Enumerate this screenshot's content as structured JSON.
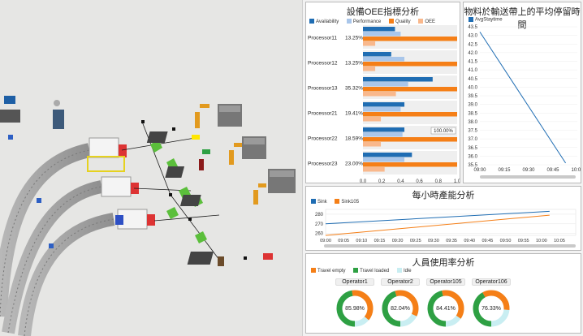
{
  "scene": {
    "description_icons": [
      "conveyor",
      "processor",
      "robot-arm",
      "operator",
      "machine",
      "queue",
      "sink",
      "network-node"
    ]
  },
  "oee": {
    "title": "設備OEE指標分析",
    "legend": [
      {
        "name": "Availability",
        "color": "#1f6db3"
      },
      {
        "name": "Performance",
        "color": "#a9c6ea"
      },
      {
        "name": "Quality",
        "color": "#f57f17"
      },
      {
        "name": "OEE",
        "color": "#f9b88c"
      }
    ],
    "rows": [
      {
        "name": "Processor11",
        "pct": "13.25%",
        "values": [
          0.34,
          0.4,
          1.0,
          0.13
        ]
      },
      {
        "name": "Processor12",
        "pct": "13.25%",
        "values": [
          0.3,
          0.44,
          1.0,
          0.13
        ]
      },
      {
        "name": "Processor13",
        "pct": "35.32%",
        "values": [
          0.74,
          0.48,
          1.0,
          0.35
        ]
      },
      {
        "name": "Processor21",
        "pct": "19.41%",
        "values": [
          0.44,
          0.4,
          1.0,
          0.19
        ]
      },
      {
        "name": "Processor22",
        "pct": "18.59%",
        "values": [
          0.44,
          0.42,
          1.0,
          0.19
        ]
      },
      {
        "name": "Processor23",
        "pct": "23.00%",
        "values": [
          0.52,
          0.44,
          1.0,
          0.23
        ]
      }
    ],
    "xticks": [
      "0.0",
      "0.2",
      "0.4",
      "0.6",
      "0.8",
      "1.0"
    ],
    "tooltip": "100.00%"
  },
  "stay": {
    "title": "物料於輸送帶上的平均停留時間",
    "legend": "AvgStaytime",
    "yticks": [
      "43.5",
      "43.0",
      "42.5",
      "42.0",
      "41.5",
      "41.0",
      "40.5",
      "40.0",
      "39.5",
      "39.0",
      "38.5",
      "38.0",
      "37.5",
      "37.0",
      "36.5",
      "36.0",
      "35.5"
    ],
    "xticks": [
      "09:00",
      "09:15",
      "09:30",
      "09:45",
      "10:00"
    ],
    "line_color": "#1f6db3"
  },
  "throughput": {
    "title": "每小時產能分析",
    "legend": [
      {
        "name": "Sink",
        "color": "#1f6db3"
      },
      {
        "name": "Sink105",
        "color": "#f57f17"
      }
    ],
    "yticks": [
      "280",
      "270",
      "260"
    ],
    "xticks": [
      "09:00",
      "09:05",
      "09:10",
      "09:15",
      "09:20",
      "09:25",
      "09:30",
      "09:35",
      "09:40",
      "09:45",
      "09:50",
      "09:55",
      "10:00",
      "10:05"
    ]
  },
  "staff": {
    "title": "人員使用率分析",
    "legend": [
      {
        "name": "Travel empty",
        "color": "#f57f17"
      },
      {
        "name": "Travel loaded",
        "color": "#2ea043"
      },
      {
        "name": "Idle",
        "color": "#c9eef2"
      }
    ],
    "operators": [
      {
        "name": "Operator1",
        "value": "85.98%"
      },
      {
        "name": "Operator2",
        "value": "82.04%"
      },
      {
        "name": "Operator105",
        "value": "84.41%"
      },
      {
        "name": "Operator106",
        "value": "76.33%"
      }
    ]
  },
  "chart_data": [
    {
      "type": "bar",
      "title": "設備OEE指標分析",
      "categories": [
        "Processor11",
        "Processor12",
        "Processor13",
        "Processor21",
        "Processor22",
        "Processor23"
      ],
      "series": [
        {
          "name": "Availability",
          "values": [
            0.34,
            0.3,
            0.74,
            0.44,
            0.44,
            0.52
          ]
        },
        {
          "name": "Performance",
          "values": [
            0.4,
            0.44,
            0.48,
            0.4,
            0.42,
            0.44
          ]
        },
        {
          "name": "Quality",
          "values": [
            1.0,
            1.0,
            1.0,
            1.0,
            1.0,
            1.0
          ]
        },
        {
          "name": "OEE",
          "values": [
            0.1325,
            0.1325,
            0.3532,
            0.1941,
            0.1859,
            0.23
          ]
        }
      ],
      "xlim": [
        0,
        1.0
      ]
    },
    {
      "type": "line",
      "title": "物料於輸送帶上的平均停留時間",
      "x": [
        "09:00",
        "10:00"
      ],
      "series": [
        {
          "name": "AvgStaytime",
          "values": [
            43.2,
            35.6
          ]
        }
      ],
      "ylim": [
        35.5,
        43.5
      ]
    },
    {
      "type": "line",
      "title": "每小時產能分析",
      "x": [
        "09:00",
        "10:00"
      ],
      "series": [
        {
          "name": "Sink",
          "values": [
            270,
            283
          ]
        },
        {
          "name": "Sink105",
          "values": [
            258,
            279
          ]
        }
      ],
      "ylim": [
        258,
        285
      ]
    },
    {
      "type": "pie",
      "title": "人員使用率分析",
      "categories": [
        "Operator1",
        "Operator2",
        "Operator105",
        "Operator106"
      ],
      "values": [
        85.98,
        82.04,
        84.41,
        76.33
      ]
    }
  ]
}
